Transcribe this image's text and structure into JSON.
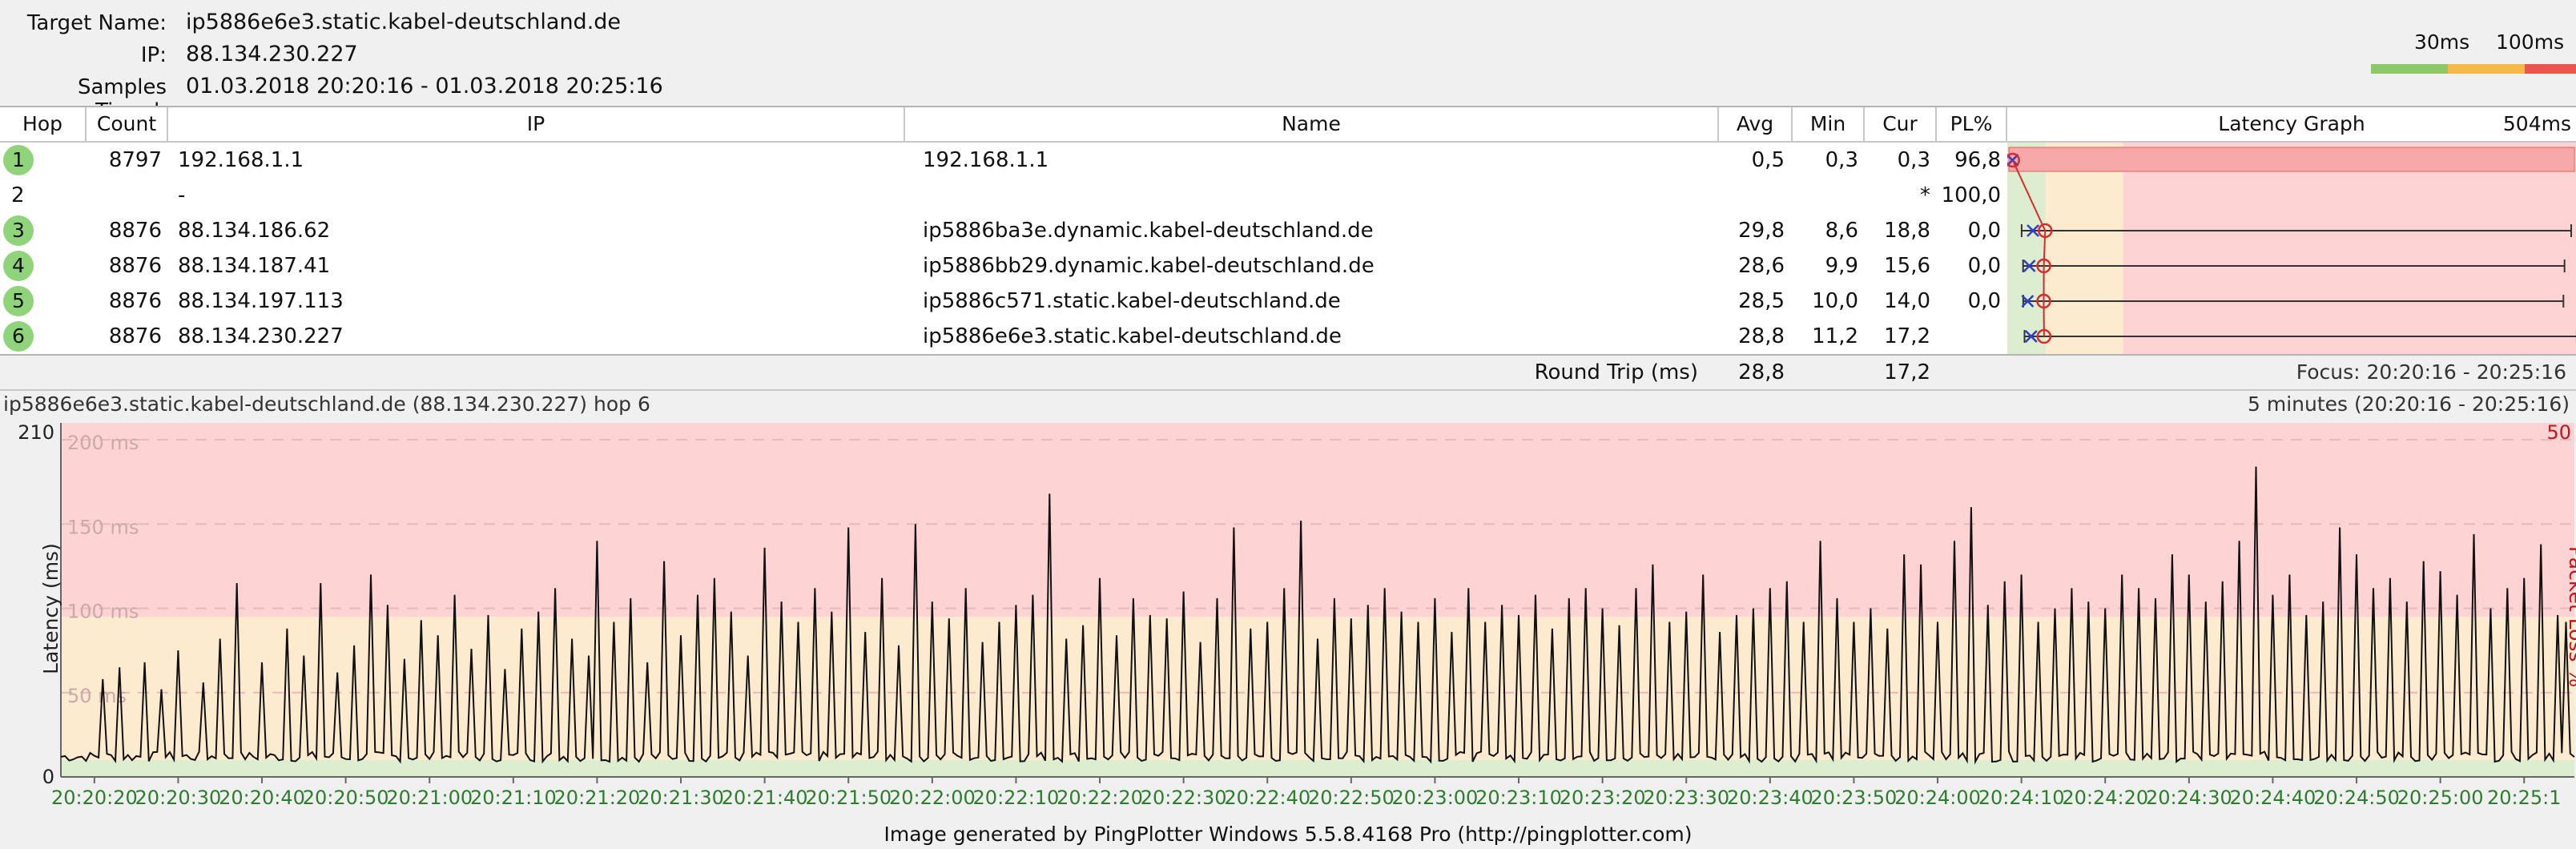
{
  "target": {
    "name_label": "Target Name:",
    "name_value": "ip5886e6e3.static.kabel-deutschland.de",
    "ip_label": "IP:",
    "ip_value": "88.134.230.227",
    "samples_label": "Samples Timed:",
    "samples_value": "01.03.2018 20:20:16 - 01.03.2018 20:25:16"
  },
  "scale_legend": {
    "low": "30ms",
    "high": "100ms",
    "colors": [
      "#8cc86a",
      "#f5b94a",
      "#e9564e"
    ]
  },
  "table": {
    "headers": {
      "hop": "Hop",
      "count": "Count",
      "ip": "IP",
      "name": "Name",
      "avg": "Avg",
      "min": "Min",
      "cur": "Cur",
      "pl": "PL%",
      "graph": "Latency Graph",
      "graph_max": "504ms"
    },
    "rows": [
      {
        "hop": "1",
        "count": "8797",
        "ip": "192.168.1.1",
        "name": "192.168.1.1",
        "avg": "0,5",
        "min": "0,3",
        "cur": "0,3",
        "pl": "96,8",
        "badge": true
      },
      {
        "hop": "2",
        "count": "",
        "ip": "-",
        "name": "",
        "avg": "",
        "min": "",
        "cur": "*",
        "pl": "100,0",
        "badge": false
      },
      {
        "hop": "3",
        "count": "8876",
        "ip": "88.134.186.62",
        "name": "ip5886ba3e.dynamic.kabel-deutschland.de",
        "avg": "29,8",
        "min": "8,6",
        "cur": "18,8",
        "pl": "0,0",
        "badge": true
      },
      {
        "hop": "4",
        "count": "8876",
        "ip": "88.134.187.41",
        "name": "ip5886bb29.dynamic.kabel-deutschland.de",
        "avg": "28,6",
        "min": "9,9",
        "cur": "15,6",
        "pl": "0,0",
        "badge": true
      },
      {
        "hop": "5",
        "count": "8876",
        "ip": "88.134.197.113",
        "name": "ip5886c571.static.kabel-deutschland.de",
        "avg": "28,5",
        "min": "10,0",
        "cur": "14,0",
        "pl": "0,0",
        "badge": true
      },
      {
        "hop": "6",
        "count": "8876",
        "ip": "88.134.230.227",
        "name": "ip5886e6e3.static.kabel-deutschland.de",
        "avg": "28,8",
        "min": "11,2",
        "cur": "17,2",
        "pl": "",
        "badge": true
      }
    ],
    "latency_graph_ms": [
      {
        "min": 0.3,
        "avg": 0.5,
        "cur": 0.3,
        "max": null
      },
      null,
      {
        "min": 8.6,
        "avg": 29.8,
        "cur": 18.8,
        "max": 504
      },
      {
        "min": 9.9,
        "avg": 28.6,
        "cur": 15.6,
        "max": 498
      },
      {
        "min": 10.0,
        "avg": 28.5,
        "cur": 14.0,
        "max": 497
      },
      {
        "min": 11.2,
        "avg": 28.8,
        "cur": 17.2,
        "max": 509
      }
    ],
    "footer": {
      "label": "Round Trip (ms)",
      "avg": "28,8",
      "cur": "17,2",
      "focus": "Focus: 20:20:16 - 20:25:16"
    }
  },
  "chart_title": {
    "left": "ip5886e6e3.static.kabel-deutschland.de (88.134.230.227) hop 6",
    "right": "5 minutes (20:20:16 - 20:25:16)"
  },
  "chart_data": {
    "type": "line",
    "ylabel": "Latency (ms)",
    "y2label": "Packet Loss %",
    "ylim": [
      0,
      210
    ],
    "y_ticks": [
      "210",
      "0"
    ],
    "y2_ticks": [
      "50"
    ],
    "band_labels": [
      "200 ms",
      "150 ms",
      "100 ms",
      "50 ms"
    ],
    "zones": [
      {
        "from": 0,
        "to": 10,
        "color": "#dcedd0"
      },
      {
        "from": 10,
        "to": 95,
        "color": "#fdebd0"
      },
      {
        "from": 95,
        "to": 210,
        "color": "#fdd3d3"
      }
    ],
    "x_ticks": [
      "20:20:20",
      "20:20:30",
      "20:20:40",
      "20:20:50",
      "20:21:00",
      "20:21:10",
      "20:21:20",
      "20:21:30",
      "20:21:40",
      "20:21:50",
      "20:22:00",
      "20:22:10",
      "20:22:20",
      "20:22:30",
      "20:22:40",
      "20:22:50",
      "20:23:00",
      "20:23:10",
      "20:23:20",
      "20:23:30",
      "20:23:40",
      "20:23:50",
      "20:24:00",
      "20:24:10",
      "20:24:20",
      "20:24:30",
      "20:24:40",
      "20:24:50",
      "20:25:00",
      "20:25:1"
    ],
    "x_range_seconds": [
      16,
      316
    ],
    "baseline_ms": 12,
    "spikes": [
      [
        21,
        58
      ],
      [
        23,
        65
      ],
      [
        26,
        68
      ],
      [
        28,
        52
      ],
      [
        30,
        75
      ],
      [
        33,
        56
      ],
      [
        35,
        82
      ],
      [
        37,
        115
      ],
      [
        40,
        68
      ],
      [
        43,
        88
      ],
      [
        45,
        72
      ],
      [
        47,
        115
      ],
      [
        49,
        62
      ],
      [
        51,
        78
      ],
      [
        53,
        120
      ],
      [
        55,
        102
      ],
      [
        57,
        70
      ],
      [
        59,
        93
      ],
      [
        61,
        84
      ],
      [
        63,
        108
      ],
      [
        65,
        76
      ],
      [
        67,
        96
      ],
      [
        69,
        64
      ],
      [
        71,
        88
      ],
      [
        73,
        98
      ],
      [
        75,
        112
      ],
      [
        77,
        82
      ],
      [
        79,
        72
      ],
      [
        80,
        140
      ],
      [
        82,
        92
      ],
      [
        84,
        106
      ],
      [
        86,
        68
      ],
      [
        88,
        128
      ],
      [
        90,
        84
      ],
      [
        92,
        108
      ],
      [
        94,
        118
      ],
      [
        96,
        98
      ],
      [
        98,
        72
      ],
      [
        100,
        136
      ],
      [
        102,
        104
      ],
      [
        104,
        92
      ],
      [
        106,
        112
      ],
      [
        108,
        98
      ],
      [
        110,
        148
      ],
      [
        112,
        86
      ],
      [
        114,
        118
      ],
      [
        116,
        78
      ],
      [
        118,
        150
      ],
      [
        120,
        104
      ],
      [
        122,
        94
      ],
      [
        124,
        112
      ],
      [
        126,
        80
      ],
      [
        128,
        92
      ],
      [
        130,
        102
      ],
      [
        132,
        108
      ],
      [
        134,
        168
      ],
      [
        136,
        82
      ],
      [
        138,
        90
      ],
      [
        140,
        118
      ],
      [
        142,
        84
      ],
      [
        144,
        106
      ],
      [
        146,
        96
      ],
      [
        148,
        94
      ],
      [
        150,
        110
      ],
      [
        152,
        80
      ],
      [
        154,
        106
      ],
      [
        156,
        148
      ],
      [
        158,
        88
      ],
      [
        160,
        92
      ],
      [
        162,
        112
      ],
      [
        164,
        152
      ],
      [
        166,
        82
      ],
      [
        168,
        106
      ],
      [
        170,
        94
      ],
      [
        172,
        102
      ],
      [
        174,
        112
      ],
      [
        176,
        98
      ],
      [
        178,
        92
      ],
      [
        180,
        106
      ],
      [
        182,
        86
      ],
      [
        184,
        112
      ],
      [
        186,
        92
      ],
      [
        188,
        102
      ],
      [
        190,
        96
      ],
      [
        192,
        108
      ],
      [
        194,
        88
      ],
      [
        196,
        106
      ],
      [
        198,
        112
      ],
      [
        200,
        100
      ],
      [
        202,
        90
      ],
      [
        204,
        112
      ],
      [
        206,
        126
      ],
      [
        208,
        92
      ],
      [
        210,
        98
      ],
      [
        212,
        120
      ],
      [
        214,
        86
      ],
      [
        216,
        96
      ],
      [
        218,
        100
      ],
      [
        220,
        112
      ],
      [
        222,
        116
      ],
      [
        224,
        92
      ],
      [
        226,
        140
      ],
      [
        228,
        106
      ],
      [
        230,
        92
      ],
      [
        232,
        100
      ],
      [
        234,
        88
      ],
      [
        236,
        132
      ],
      [
        238,
        126
      ],
      [
        240,
        92
      ],
      [
        242,
        140
      ],
      [
        244,
        160
      ],
      [
        246,
        102
      ],
      [
        248,
        116
      ],
      [
        250,
        120
      ],
      [
        252,
        92
      ],
      [
        254,
        100
      ],
      [
        256,
        112
      ],
      [
        258,
        104
      ],
      [
        260,
        100
      ],
      [
        262,
        120
      ],
      [
        264,
        112
      ],
      [
        266,
        106
      ],
      [
        268,
        132
      ],
      [
        270,
        120
      ],
      [
        272,
        104
      ],
      [
        274,
        116
      ],
      [
        276,
        140
      ],
      [
        278,
        184
      ],
      [
        280,
        108
      ],
      [
        282,
        120
      ],
      [
        284,
        96
      ],
      [
        286,
        104
      ],
      [
        288,
        148
      ],
      [
        290,
        132
      ],
      [
        292,
        112
      ],
      [
        294,
        118
      ],
      [
        296,
        104
      ],
      [
        298,
        128
      ],
      [
        300,
        122
      ],
      [
        302,
        108
      ],
      [
        304,
        144
      ],
      [
        306,
        100
      ],
      [
        308,
        112
      ],
      [
        310,
        118
      ],
      [
        312,
        138
      ],
      [
        314,
        96
      ],
      [
        315,
        92
      ]
    ]
  },
  "footer": {
    "text": "Image generated by PingPlotter Windows 5.5.8.4168 Pro (http://pingplotter.com)"
  }
}
